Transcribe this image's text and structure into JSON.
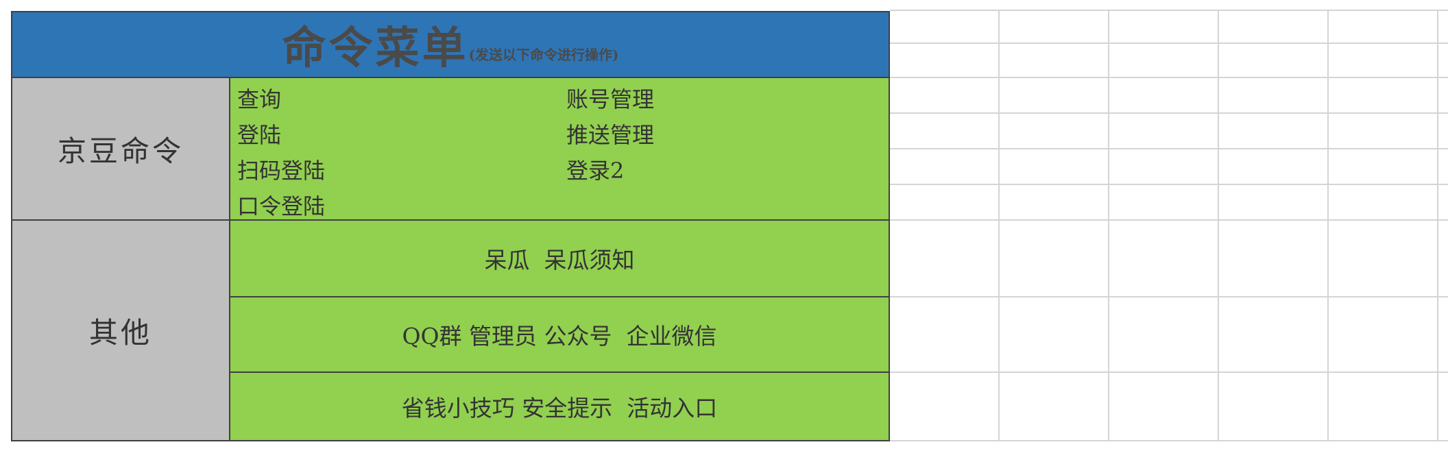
{
  "title": {
    "main": "命令菜单",
    "sub": "(发送以下命令进行操作)"
  },
  "categories": {
    "jd": "京豆命令",
    "other": "其他"
  },
  "jd_commands": {
    "left": [
      "查询",
      "登陆",
      "扫码登陆",
      "口令登陆"
    ],
    "right": [
      "账号管理",
      "推送管理",
      "登录2"
    ]
  },
  "other_rows": [
    "呆瓜  呆瓜须知",
    "QQ群 管理员 公众号  企业微信",
    "省钱小技巧 安全提示  活动入口"
  ],
  "colors": {
    "header_blue": "#2e75b6",
    "command_green": "#92d050",
    "category_gray": "#bfbfbf"
  }
}
